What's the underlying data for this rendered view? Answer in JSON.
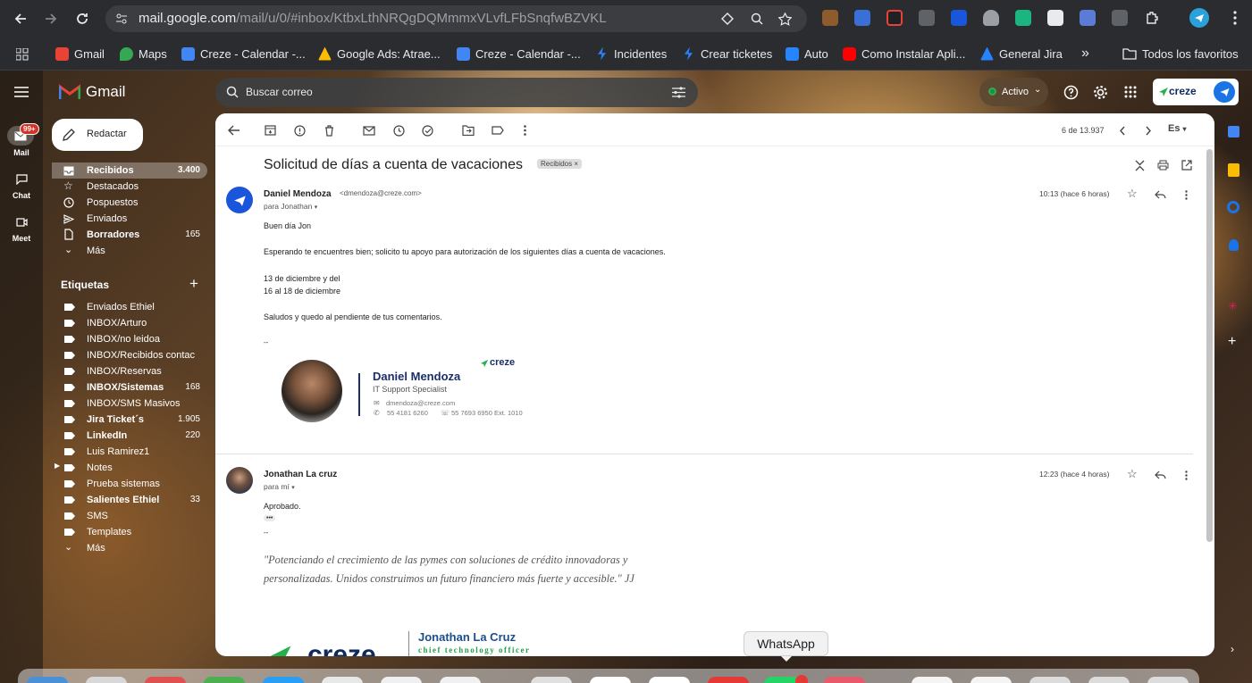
{
  "browser": {
    "url_host": "mail.google.com",
    "url_path": "/mail/u/0/#inbox/KtbxLthNRQgDQMmmxVLvfLFbSnqfwBZVKL",
    "bookmarks": [
      {
        "label": "Gmail",
        "color": "#ea4335"
      },
      {
        "label": "Maps",
        "color": "#34a853"
      },
      {
        "label": "Creze - Calendar -...",
        "color": "#4285f4"
      },
      {
        "label": "Google Ads: Atrae...",
        "color": "#fbbc04"
      },
      {
        "label": "Creze - Calendar -...",
        "color": "#4285f4"
      },
      {
        "label": "Incidentes",
        "color": "#2684ff"
      },
      {
        "label": "Crear ticketes",
        "color": "#2684ff"
      },
      {
        "label": "Auto",
        "color": "#2684ff"
      },
      {
        "label": "Como Instalar Apli...",
        "color": "#ff0000"
      },
      {
        "label": "General Jira",
        "color": "#2684ff"
      }
    ],
    "more_label": "»",
    "all_favorites": "Todos los favoritos"
  },
  "gmail": {
    "logo_text": "Gmail",
    "search_placeholder": "Buscar correo",
    "status": "Activo",
    "brand": "creze",
    "compose": "Redactar",
    "rail": [
      {
        "label": "Mail",
        "badge": "99+"
      },
      {
        "label": "Chat"
      },
      {
        "label": "Meet"
      }
    ],
    "folders": [
      {
        "label": "Recibidos",
        "count": "3.400",
        "bold": true,
        "active": true
      },
      {
        "label": "Destacados",
        "count": ""
      },
      {
        "label": "Pospuestos",
        "count": ""
      },
      {
        "label": "Enviados",
        "count": ""
      },
      {
        "label": "Borradores",
        "count": "165",
        "bold": true
      },
      {
        "label": "Más",
        "count": ""
      }
    ],
    "labels_title": "Etiquetas",
    "labels": [
      {
        "label": "Enviados Ethiel",
        "count": ""
      },
      {
        "label": "INBOX/Arturo",
        "count": ""
      },
      {
        "label": "INBOX/no leidoa",
        "count": ""
      },
      {
        "label": "INBOX/Recibidos contac",
        "count": ""
      },
      {
        "label": "INBOX/Reservas",
        "count": ""
      },
      {
        "label": "INBOX/Sistemas",
        "count": "168",
        "bold": true
      },
      {
        "label": "INBOX/SMS Masivos",
        "count": ""
      },
      {
        "label": "Jira Ticket´s",
        "count": "1.905",
        "bold": true
      },
      {
        "label": "LinkedIn",
        "count": "220",
        "bold": true
      },
      {
        "label": "Luis Ramirez1",
        "count": ""
      },
      {
        "label": "Notes",
        "count": ""
      },
      {
        "label": "Prueba sistemas",
        "count": ""
      },
      {
        "label": "Salientes Ethiel",
        "count": "33",
        "bold": true
      },
      {
        "label": "SMS",
        "count": ""
      },
      {
        "label": "Templates",
        "count": ""
      },
      {
        "label": "Más",
        "count": ""
      }
    ],
    "pager": "6 de 13.937",
    "lang": "Es",
    "subject": "Solicitud de días a cuenta de vacaciones",
    "subject_tag": "Recibidos",
    "msg1": {
      "sender": "Daniel Mendoza",
      "email": "<dmendoza@creze.com>",
      "to": "para Jonathan",
      "time": "10:13 (hace 6 horas)",
      "greeting": "Buen día Jon",
      "body1": "Esperando te encuentres bien; solicito tu apoyo para autorización de los siguientes días a cuenta de vacaciones.",
      "date1": "13 de diciembre y del",
      "date2": "16 al 18 de diciembre",
      "closing": "Saludos y quedo al pendiente de tus comentarios.",
      "sep": "--",
      "sig_name": "Daniel Mendoza",
      "sig_title": "IT Support Specialist",
      "sig_brand": "creze",
      "sig_email": "dmendoza@creze.com",
      "sig_phone1": "55 4181 6260",
      "sig_phone2": "55 7693 6950 Ext. 1010"
    },
    "msg2": {
      "sender": "Jonathan La cruz",
      "to": "para mí",
      "time": "12:23 (hace 4 horas)",
      "body": "Aprobado.",
      "dots": "•••",
      "sep": "--",
      "quote": "\"Potenciando el crecimiento de las pymes con soluciones de crédito innovadoras y personalizadas. Unidos construimos un futuro financiero más fuerte y accesible.\" JJ",
      "sig_name": "Jonathan La Cruz",
      "sig_title": "chief technology officer"
    },
    "tooltip": "WhatsApp"
  }
}
